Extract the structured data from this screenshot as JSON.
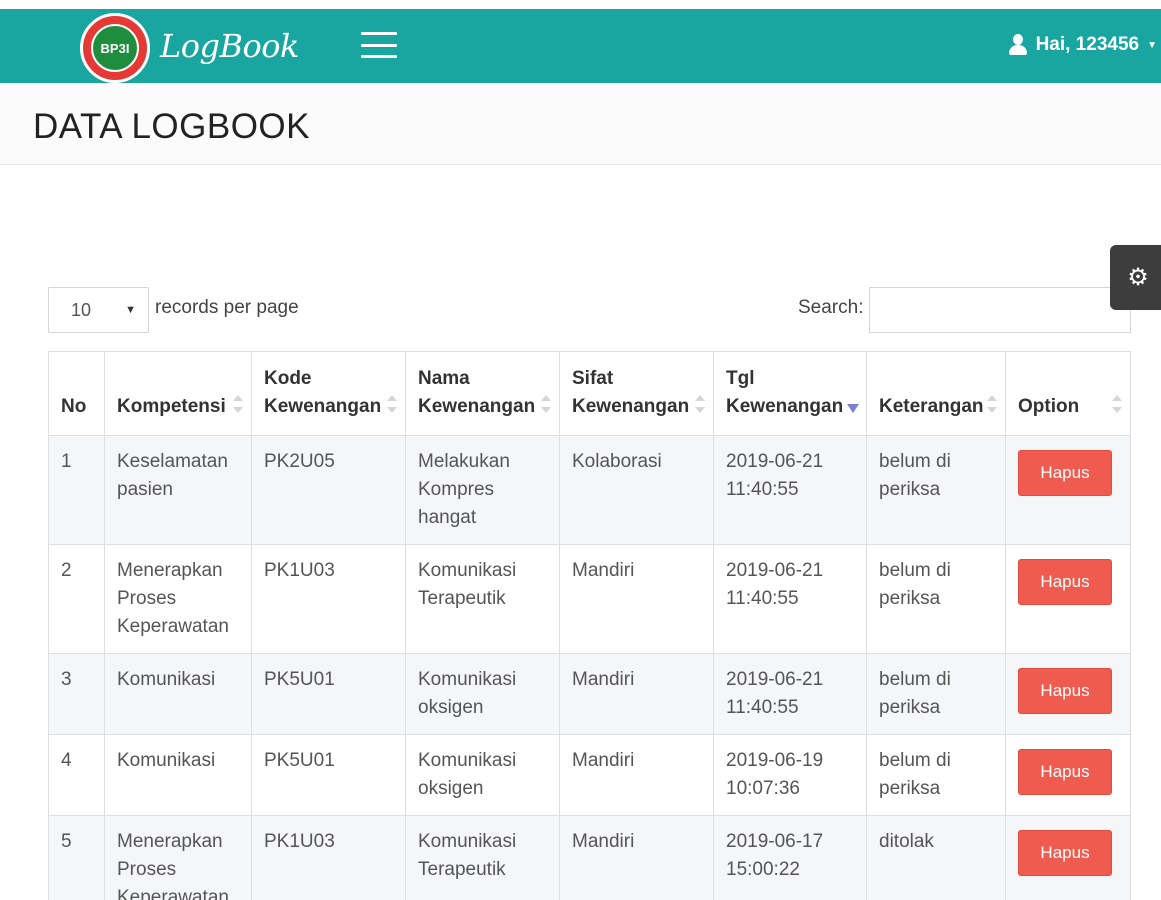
{
  "header": {
    "logo_text": "BP3I",
    "app_name": "LogBook",
    "user_greeting": "Hai, 123456"
  },
  "page": {
    "title": "DATA LOGBOOK"
  },
  "controls": {
    "page_length": "10",
    "page_length_label": "records per page",
    "search_label": "Search:",
    "search_value": ""
  },
  "table": {
    "columns": [
      "No",
      "Kompetensi",
      "Kode Kewenangan",
      "Nama Kewenangan",
      "Sifat Kewenangan",
      "Tgl Kewenangan",
      "Keterangan",
      "Option"
    ],
    "rows": [
      {
        "no": "1",
        "kompetensi": "Keselamatan pasien",
        "kode": "PK2U05",
        "nama": "Melakukan Kompres hangat",
        "sifat": "Kolaborasi",
        "tgl": "2019-06-21 11:40:55",
        "keterangan": "belum di periksa",
        "action": "Hapus"
      },
      {
        "no": "2",
        "kompetensi": "Menerapkan Proses Keperawatan",
        "kode": "PK1U03",
        "nama": "Komunikasi Terapeutik",
        "sifat": "Mandiri",
        "tgl": "2019-06-21 11:40:55",
        "keterangan": "belum di periksa",
        "action": "Hapus"
      },
      {
        "no": "3",
        "kompetensi": "Komunikasi",
        "kode": "PK5U01",
        "nama": "Komunikasi oksigen",
        "sifat": "Mandiri",
        "tgl": "2019-06-21 11:40:55",
        "keterangan": "belum di periksa",
        "action": "Hapus"
      },
      {
        "no": "4",
        "kompetensi": "Komunikasi",
        "kode": "PK5U01",
        "nama": "Komunikasi oksigen",
        "sifat": "Mandiri",
        "tgl": "2019-06-19 10:07:36",
        "keterangan": "belum di periksa",
        "action": "Hapus"
      },
      {
        "no": "5",
        "kompetensi": "Menerapkan Proses Keperawatan",
        "kode": "PK1U03",
        "nama": "Komunikasi Terapeutik",
        "sifat": "Mandiri",
        "tgl": "2019-06-17 15:00:22",
        "keterangan": "ditolak",
        "action": "Hapus"
      }
    ]
  },
  "icons": {
    "menu": "hamburger-icon",
    "user": "user-icon",
    "settings": "gear-icon"
  },
  "colors": {
    "topbar": "#1aa6a0",
    "delete_button": "#f05b4f",
    "settings_tab": "#3d3d3d"
  }
}
